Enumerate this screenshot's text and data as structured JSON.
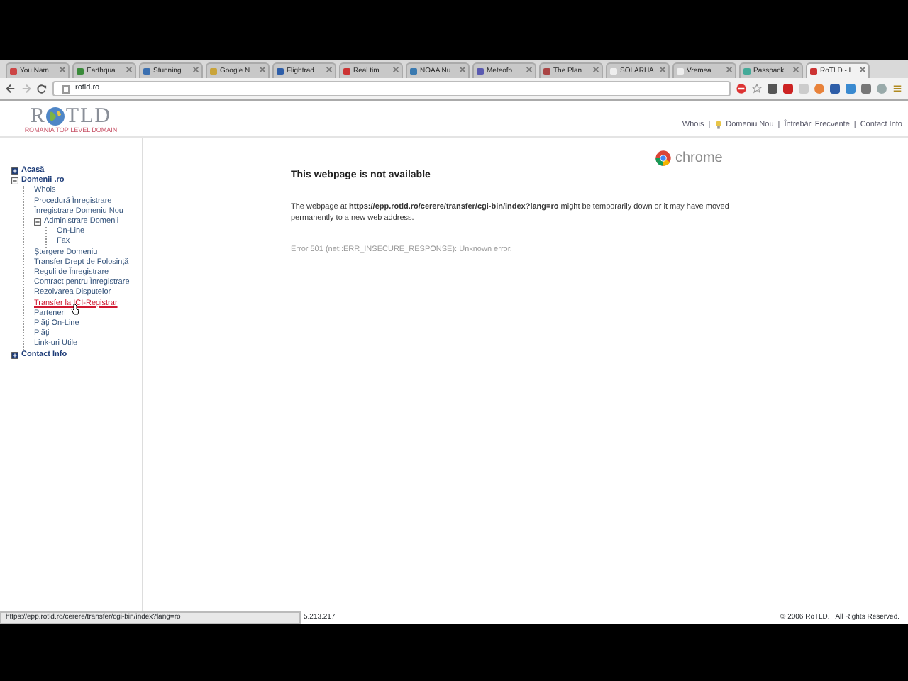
{
  "browser": {
    "tabs": [
      {
        "title": "You Nam",
        "selected": false
      },
      {
        "title": "Earthqua",
        "selected": false
      },
      {
        "title": "Stunning",
        "selected": false
      },
      {
        "title": "Google N",
        "selected": false
      },
      {
        "title": "Flightrad",
        "selected": false
      },
      {
        "title": "Real tim",
        "selected": false
      },
      {
        "title": "NOAA Nu",
        "selected": false
      },
      {
        "title": "Meteofo",
        "selected": false
      },
      {
        "title": "The Plan",
        "selected": false
      },
      {
        "title": "SOLARHA",
        "selected": false
      },
      {
        "title": "Vremea",
        "selected": false
      },
      {
        "title": "Passpack",
        "selected": false
      },
      {
        "title": "RoTLD - I",
        "selected": true
      }
    ],
    "address": "rotld.ro"
  },
  "site": {
    "logo_left": "R",
    "logo_right": "TLD",
    "tagline": "ROMANIA TOP LEVEL DOMAIN",
    "top_links": [
      "Whois",
      "Domeniu Nou",
      "Întrebări Frecvente",
      "Contact Info"
    ],
    "link_separator": "|",
    "nav": [
      {
        "label": "Acasă",
        "expanded": false,
        "hovered": false
      },
      {
        "label": "Domenii .ro",
        "expanded": true,
        "hovered": false,
        "children": [
          {
            "label": "Whois",
            "hovered": false
          },
          {
            "label": "Procedură Înregistrare",
            "hovered": false
          },
          {
            "label": "Înregistrare Domeniu Nou",
            "hovered": false
          },
          {
            "label": "Administrare Domenii",
            "expanded": true,
            "hovered": false,
            "children": [
              {
                "label": "On-Line",
                "hovered": false
              },
              {
                "label": "Fax",
                "hovered": false
              }
            ]
          },
          {
            "label": "Ştergere Domeniu",
            "hovered": false
          },
          {
            "label": "Transfer Drept de Folosinţă",
            "hovered": false
          },
          {
            "label": "Reguli de Înregistrare",
            "hovered": false
          },
          {
            "label": "Contract pentru Înregistrare",
            "hovered": false
          },
          {
            "label": "Rezolvarea Disputelor",
            "hovered": false
          },
          {
            "label": "Transfer la ICI-Registrar",
            "hovered": true
          },
          {
            "label": "Parteneri",
            "hovered": false
          },
          {
            "label": "Plăţi On-Line",
            "hovered": false
          },
          {
            "label": "Plăţi",
            "hovered": false
          },
          {
            "label": "Link-uri Utile",
            "hovered": false
          }
        ]
      },
      {
        "label": "Contact Info",
        "expanded": false,
        "hovered": false
      }
    ]
  },
  "error": {
    "title": "This webpage is not available",
    "brand": "chrome",
    "message": "The webpage at **https://epp.rotld.ro/cerere/transfer/cgi-bin/index?lang=ro** might be temporarily down or it may have moved permanently to a new web address.",
    "detail": "Error 501 (net::ERR_INSECURE_RESPONSE): Unknown error."
  },
  "status_bar": {
    "link_preview": "https://epp.rotld.ro/cerere/transfer/cgi-bin/index?lang=ro",
    "partial": "5.213.217",
    "copyright": "© 2006 RoTLD.   All Rights Reserved."
  }
}
